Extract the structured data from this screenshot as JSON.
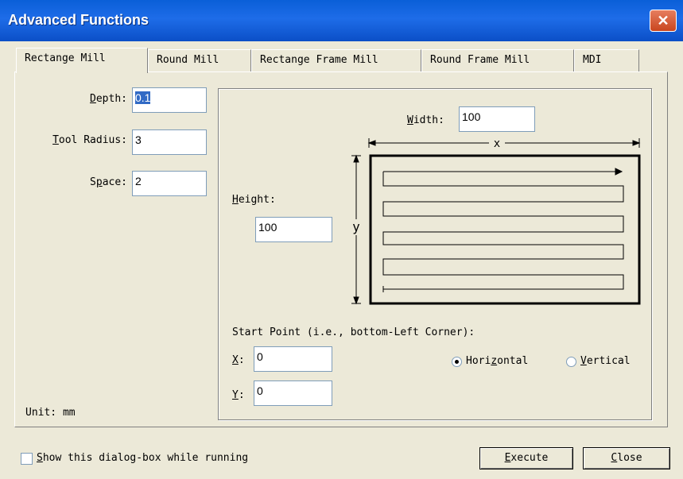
{
  "window": {
    "title": "Advanced Functions",
    "close_symbol": "✕"
  },
  "tabs": [
    {
      "label": "Rectange Mill"
    },
    {
      "label": "Round Mill"
    },
    {
      "label": "Rectange Frame Mill"
    },
    {
      "label": "Round Frame Mill"
    },
    {
      "label": "MDI"
    }
  ],
  "params": {
    "depth": {
      "label_pre": "",
      "label_ul": "D",
      "label_post": "epth:",
      "value": "0.1"
    },
    "tool_radius": {
      "label_pre": "",
      "label_ul": "T",
      "label_post": "ool Radius:",
      "value": "3"
    },
    "space": {
      "label_pre": "S",
      "label_ul": "p",
      "label_post": "ace:",
      "value": "2"
    }
  },
  "width": {
    "label_pre": "",
    "label_ul": "W",
    "label_post": "idth:",
    "value": "100"
  },
  "height": {
    "label_pre": "",
    "label_ul": "H",
    "label_post": "eight:",
    "value": "100"
  },
  "diagram": {
    "x_label": "x",
    "y_label": "y"
  },
  "start_point": {
    "label": "Start Point (i.e., bottom-Left Corner):",
    "x": {
      "label_ul": "X",
      "label_post": ":",
      "value": "0"
    },
    "y": {
      "label_ul": "Y",
      "label_post": ":",
      "value": "0"
    }
  },
  "direction": {
    "horizontal": {
      "label_pre": "Hori",
      "label_ul": "z",
      "label_post": "ontal",
      "selected": true
    },
    "vertical": {
      "label_pre": "",
      "label_ul": "V",
      "label_post": "ertical",
      "selected": false
    }
  },
  "unit_label": "Unit: mm",
  "show_dialog": {
    "label_ul": "S",
    "label_post": "how this dialog-box while running",
    "checked": false
  },
  "buttons": {
    "execute": {
      "label_ul": "E",
      "label_post": "xecute"
    },
    "close": {
      "label_ul": "C",
      "label_post": "lose"
    }
  }
}
